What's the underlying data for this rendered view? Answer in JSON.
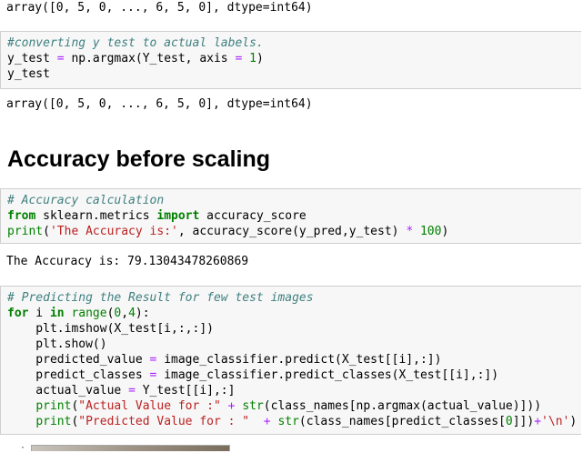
{
  "outputs": {
    "array_1": "array([0, 5, 0, ..., 6, 5, 0], dtype=int64)",
    "array_2": "array([0, 5, 0, ..., 6, 5, 0], dtype=int64)",
    "accuracy": "The Accuracy is: 79.13043478260869"
  },
  "heading": "Accuracy before scaling",
  "cell_convert": {
    "comment": "#converting y test to actual labels.",
    "line2": {
      "a": "y_test ",
      "op1": "=",
      "b": " np.argmax(Y_test, axis ",
      "op2": "=",
      "c": " ",
      "num": "1",
      "d": ")"
    },
    "line3": "y_test"
  },
  "cell_accuracy": {
    "comment": "# Accuracy calculation",
    "line2": {
      "kw1": "from",
      "mod": " sklearn.metrics ",
      "kw2": "import",
      "name": " accuracy_score"
    },
    "line3": {
      "fn": "print",
      "a": "(",
      "str": "'The Accuracy is:'",
      "b": ", accuracy_score(y_pred,y_test) ",
      "op": "*",
      "c": " ",
      "num": "100",
      "d": ")"
    }
  },
  "cell_predict": {
    "comment": "# Predicting the Result for few test images",
    "line2": {
      "kw1": "for",
      "a": " i ",
      "kw2": "in",
      "b": " ",
      "fn": "range",
      "c": "(",
      "n1": "0",
      "d": ",",
      "n2": "4",
      "e": "):"
    },
    "line3": "    plt.imshow(X_test[i,:,:])",
    "line4": "    plt.show()",
    "line5": {
      "a": "    predicted_value ",
      "op": "=",
      "b": " image_classifier.predict(X_test[[i],:])"
    },
    "line6": {
      "a": "    predict_classes ",
      "op": "=",
      "b": " image_classifier.predict_classes(X_test[[i],:])"
    },
    "line7": {
      "a": "    actual_value ",
      "op": "=",
      "b": " Y_test[[i],:]"
    },
    "line8": {
      "indent": "    ",
      "fn": "print",
      "a": "(",
      "str": "\"Actual Value for :\"",
      "b": " ",
      "op": "+",
      "c": " ",
      "fn2": "str",
      "d": "(class_names[np.argmax(actual_value)]))"
    },
    "line9": {
      "indent": "    ",
      "fn": "print",
      "a": "(",
      "str": "\"Predicted Value for : \"",
      "b": "  ",
      "op": "+",
      "c": " ",
      "fn2": "str",
      "d": "(class_names[predict_classes[",
      "num": "0",
      "e": "]])",
      "op2": "+",
      "str2": "'\\n'",
      "f": ")"
    }
  }
}
